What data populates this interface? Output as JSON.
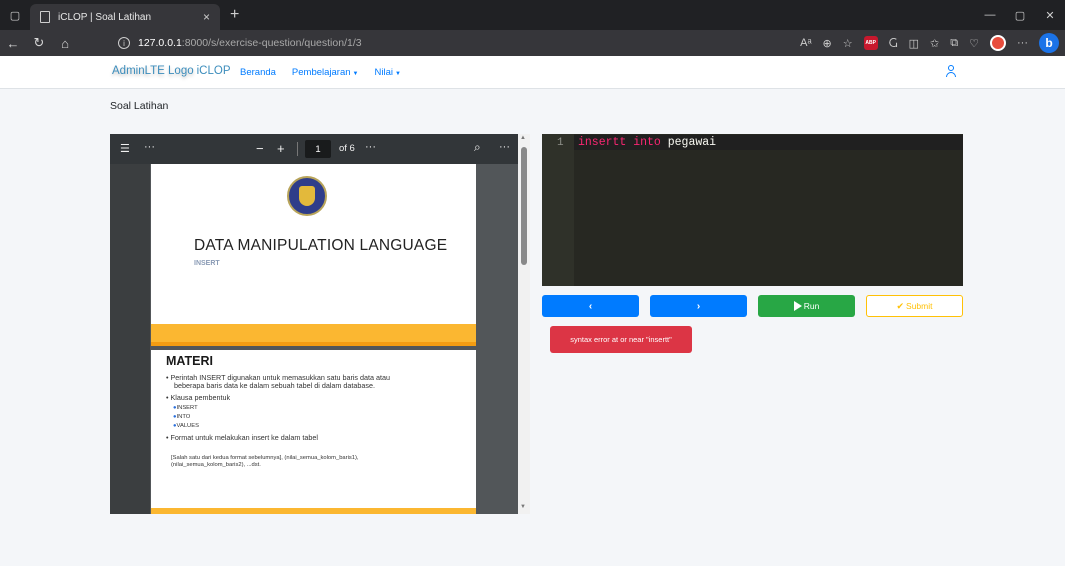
{
  "browser": {
    "tab_title": "iCLOP | Soal Latihan",
    "tab_close": "×",
    "new_tab": "+",
    "url_host": "127.0.0.1",
    "url_path": ":8000/s/exercise-question/question/1/3"
  },
  "navbar": {
    "logo_alt": "AdminLTE Logo",
    "brand": "iCLOP",
    "menu": [
      "Beranda",
      "Pembelajaran",
      "Nilai"
    ]
  },
  "page": {
    "title": "Soal Latihan"
  },
  "pdf": {
    "page_current": "1",
    "page_total": "of 6",
    "slide1": {
      "title": "DATA MANIPULATION LANGUAGE",
      "subtitle": "INSERT"
    },
    "slide2": {
      "heading": "MATERI",
      "bullets": [
        "Perintah INSERT digunakan untuk memasukkan satu baris data atau",
        "beberapa baris data ke dalam sebuah tabel di dalam database.",
        "Klausa pembentuk",
        "Format untuk melakukan insert ke dalam tabel"
      ],
      "subitems": [
        "INSERT",
        "INTO",
        "VALUES"
      ],
      "note_line1": "[Salah satu dari kedua format sebelumnya], (nilai_semua_kolom_baris1),",
      "note_line2": "(nilai_semua_kolom_baris2), ...dst."
    }
  },
  "editor": {
    "line_number": "1",
    "code_keyword": "insertt into",
    "code_identifier": "pegawai"
  },
  "buttons": {
    "prev": "‹",
    "next": "›",
    "run": "Run",
    "submit": "Submit"
  },
  "error_message": "syntax error at or near \"insertt\"",
  "colors": {
    "primary": "#007bff",
    "success": "#28a745",
    "warning": "#ffc107",
    "danger": "#dc3545",
    "editor_bg": "#272822",
    "keyword": "#f92672",
    "slide_band": "#fbb731"
  }
}
